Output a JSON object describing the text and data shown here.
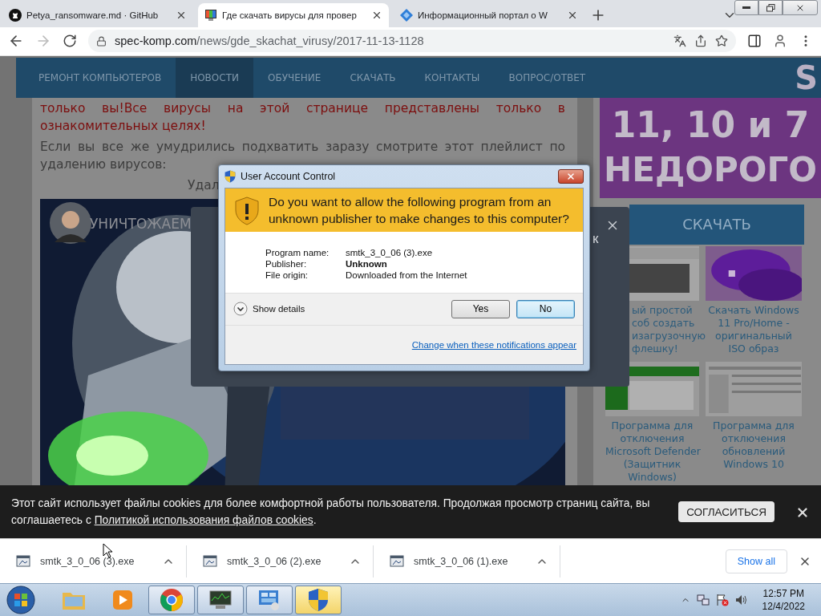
{
  "browser": {
    "tabs": [
      {
        "title": "Petya_ransomware.md · GitHub",
        "selected": false
      },
      {
        "title": "Где скачать вирусы для провер",
        "selected": true
      },
      {
        "title": "Информационный портал о W",
        "selected": false
      }
    ],
    "url_host": "spec-komp.com",
    "url_path": "/news/gde_skachat_virusy/2017-11-13-1128"
  },
  "site": {
    "nav": [
      {
        "label": "РЕМОНТ КОМПЬЮТЕРОВ",
        "selected": false
      },
      {
        "label": "НОВОСТИ",
        "selected": true
      },
      {
        "label": "ОБУЧЕНИЕ",
        "selected": false
      },
      {
        "label": "СКАЧАТЬ",
        "selected": false
      },
      {
        "label": "КОНТАКТЫ",
        "selected": false
      },
      {
        "label": "ВОПРОС/ОТВЕТ",
        "selected": false
      }
    ],
    "warning_text": "только вы!Все вирусы на этой странице представлены только в ознакомительных целях!",
    "intro_text": "Если вы все же умудрились подхватить заразу смотрите этот плейлист по удалению вирусов:",
    "video_heading_fragment": "Удал",
    "video": {
      "title": "УНИЧТОЖАЕМ"
    },
    "banner": {
      "top_fragment": "S",
      "lines": [
        "11, 10 и 7",
        "НЕДОРОГО"
      ]
    },
    "sidebar": {
      "heading": "СКАЧАТЬ",
      "cards": [
        {
          "partial": true,
          "lines": [
            "ый простой",
            "соб создать",
            "изагрузочную",
            "флешку!"
          ]
        },
        {
          "partial": false,
          "lines": [
            "Скачать Windows",
            "11 Pro/Home -",
            "оригинальный",
            "ISO образ"
          ]
        },
        {
          "partial": false,
          "lines": [
            "Программа для",
            "отключения",
            "Microsoft Defender",
            "(Защитник",
            "Windows)"
          ]
        },
        {
          "partial": false,
          "lines": [
            "Программа для",
            "отключения",
            "обновлений",
            "Windows 10"
          ]
        }
      ]
    }
  },
  "modal": {
    "text_fragment": "к"
  },
  "uac": {
    "title": "User Account Control",
    "question": "Do you want to allow the following program from an unknown publisher to make changes to this computer?",
    "fields": [
      {
        "label": "Program name:",
        "value": "smtk_3_0_06 (3).exe",
        "bold": false
      },
      {
        "label": "Publisher:",
        "value": "Unknown",
        "bold": true
      },
      {
        "label": "File origin:",
        "value": "Downloaded from the Internet",
        "bold": false
      }
    ],
    "details_label": "Show details",
    "buttons": [
      {
        "label": "Yes",
        "focused": false
      },
      {
        "label": "No",
        "focused": true
      }
    ],
    "link": "Change when these notifications appear"
  },
  "cookie_bar": {
    "text_before": "Этот сайт использует файлы cookies для более комфортной работы пользователя. Продолжая просмотр страниц сайта, вы соглашаетесь с ",
    "link": "Политикой использования файлов cookies",
    "text_after": ".",
    "accept": "СОГЛАСИТЬСЯ"
  },
  "downloads": {
    "items": [
      {
        "name": "smtk_3_0_06 (3).exe"
      },
      {
        "name": "smtk_3_0_06 (2).exe"
      },
      {
        "name": "smtk_3_0_06 (1).exe"
      }
    ],
    "show_all": "Show all"
  },
  "taskbar": {
    "apps": [
      {
        "kind": "folder",
        "running": false,
        "active": false
      },
      {
        "kind": "media",
        "running": false,
        "active": false
      },
      {
        "kind": "chrome",
        "running": true,
        "active": false
      },
      {
        "kind": "monitor",
        "running": true,
        "active": false
      },
      {
        "kind": "panel",
        "running": true,
        "active": false
      },
      {
        "kind": "shield",
        "running": true,
        "active": true
      }
    ],
    "time": "12:57 PM",
    "date": "12/4/2022"
  }
}
